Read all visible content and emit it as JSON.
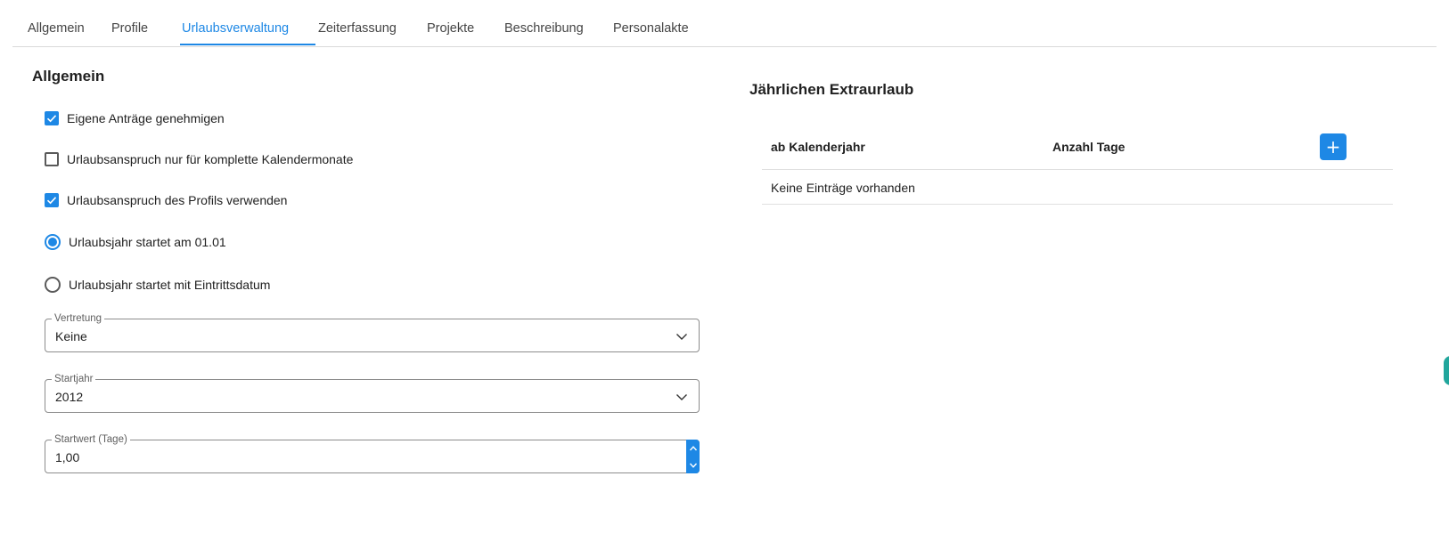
{
  "tabs": [
    {
      "label": "Allgemein",
      "active": false
    },
    {
      "label": "Profile",
      "active": false
    },
    {
      "label": "Urlaubsverwaltung",
      "active": true
    },
    {
      "label": "Zeiterfassung",
      "active": false
    },
    {
      "label": "Projekte",
      "active": false
    },
    {
      "label": "Beschreibung",
      "active": false
    },
    {
      "label": "Personalakte",
      "active": false
    }
  ],
  "general": {
    "title": "Allgemein",
    "options": [
      {
        "type": "checkbox",
        "label": "Eigene Anträge genehmigen",
        "checked": true
      },
      {
        "type": "checkbox",
        "label": "Urlaubsanspruch nur für komplette Kalendermonate",
        "checked": false
      },
      {
        "type": "checkbox",
        "label": "Urlaubsanspruch des Profils verwenden",
        "checked": true
      },
      {
        "type": "radio",
        "label": "Urlaubsjahr startet am 01.01",
        "checked": true
      },
      {
        "type": "radio",
        "label": "Urlaubsjahr startet mit Eintrittsdatum",
        "checked": false
      }
    ],
    "fields": {
      "vertretung": {
        "label": "Vertretung",
        "value": "Keine"
      },
      "startjahr": {
        "label": "Startjahr",
        "value": "2012"
      },
      "startwert": {
        "label": "Startwert (Tage)",
        "value": "1,00"
      }
    }
  },
  "extra": {
    "title": "Jährlichen Extraurlaub",
    "columns": [
      "ab Kalenderjahr",
      "Anzahl Tage"
    ],
    "add_label": "+",
    "empty_text": "Keine Einträge vorhanden"
  },
  "colors": {
    "accent": "#1e88e5",
    "side_handle": "#21a69c"
  }
}
